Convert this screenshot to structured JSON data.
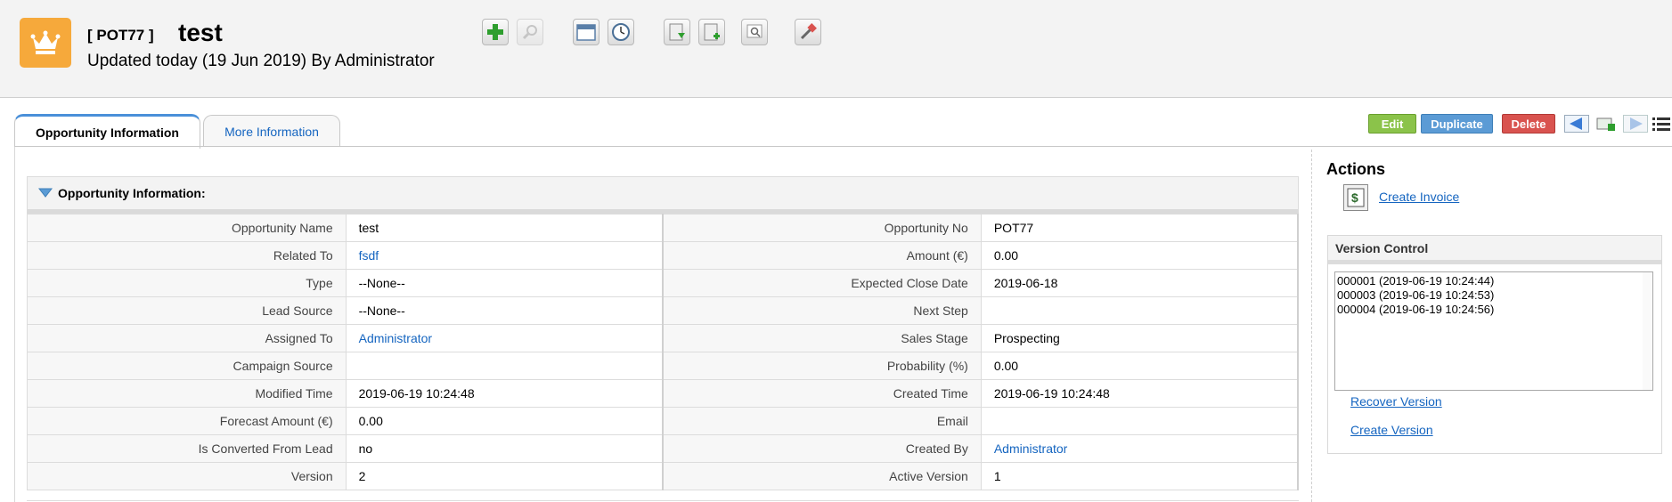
{
  "header": {
    "record_no": "[ POT77 ]",
    "title": "test",
    "updated": "Updated today (19 Jun 2019) By Administrator"
  },
  "toolbar": {
    "icons": [
      "add-icon",
      "search-icon",
      "calendar-icon",
      "clock-icon",
      "import-icon",
      "export-icon",
      "find-duplicates-icon",
      "settings-icon"
    ]
  },
  "tabs": [
    {
      "label": "Opportunity Information",
      "active": true
    },
    {
      "label": "More Information",
      "active": false
    }
  ],
  "actions_bar": {
    "edit": "Edit",
    "duplicate": "Duplicate",
    "delete": "Delete"
  },
  "section": {
    "title": "Opportunity Information:",
    "rows": [
      {
        "l1": "Opportunity Name",
        "v1": "test",
        "l2": "Opportunity No",
        "v2": "POT77"
      },
      {
        "l1": "Related To",
        "v1": "fsdf",
        "l2": "Amount (€)",
        "v2": "0.00"
      },
      {
        "l1": "Type",
        "v1": "--None--",
        "l2": "Expected Close Date",
        "v2": "2019-06-18"
      },
      {
        "l1": "Lead Source",
        "v1": "--None--",
        "l2": "Next Step",
        "v2": ""
      },
      {
        "l1": "Assigned To",
        "v1": "Administrator",
        "l2": "Sales Stage",
        "v2": "Prospecting"
      },
      {
        "l1": "Campaign Source",
        "v1": "",
        "l2": "Probability (%)",
        "v2": "0.00"
      },
      {
        "l1": "Modified Time",
        "v1": "2019-06-19 10:24:48",
        "l2": "Created Time",
        "v2": "2019-06-19 10:24:48"
      },
      {
        "l1": "Forecast Amount (€)",
        "v1": "0.00",
        "l2": "Email",
        "v2": ""
      },
      {
        "l1": "Is Converted From Lead",
        "v1": "no",
        "l2": "Created By",
        "v2": "Administrator"
      },
      {
        "l1": "Version",
        "v1": "2",
        "l2": "Active Version",
        "v2": "1"
      }
    ]
  },
  "sidebar": {
    "actions_title": "Actions",
    "create_invoice": "Create Invoice",
    "version_control": {
      "title": "Version Control",
      "versions": [
        "000001 (2019-06-19 10:24:44)",
        "000003 (2019-06-19 10:24:53)",
        "000004 (2019-06-19 10:24:56)"
      ],
      "recover": "Recover Version",
      "create": "Create Version"
    }
  }
}
